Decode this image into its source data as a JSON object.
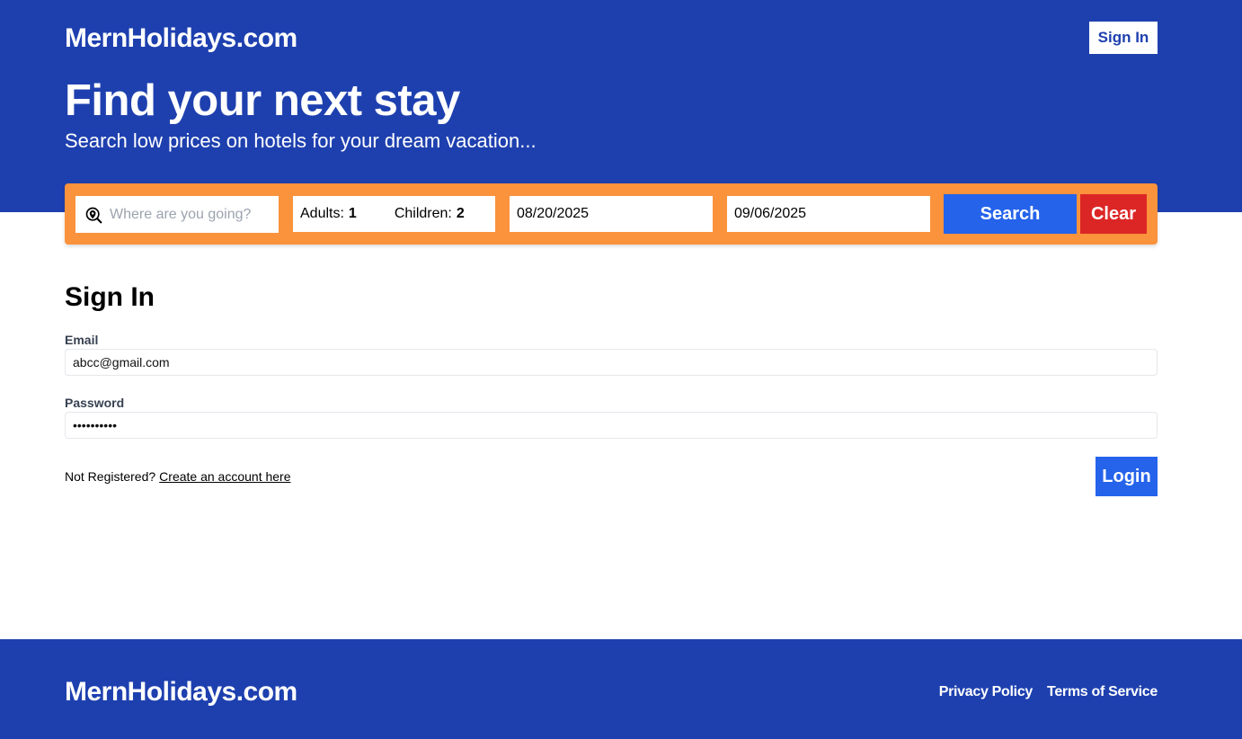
{
  "header": {
    "logo": "MernHolidays.com",
    "signin_label": "Sign In",
    "hero_title": "Find your next stay",
    "hero_subtitle": "Search low prices on hotels for your dream vacation..."
  },
  "search": {
    "destination_placeholder": "Where are you going?",
    "destination_value": "",
    "adults_label": "Adults:",
    "adults_value": "1",
    "children_label": "Children:",
    "children_value": "2",
    "check_in": "08/20/2025",
    "check_out": "09/06/2025",
    "search_label": "Search",
    "clear_label": "Clear"
  },
  "signin_form": {
    "title": "Sign In",
    "email_label": "Email",
    "email_value": "abcc@gmail.com",
    "password_label": "Password",
    "password_value": "••••••••••",
    "not_registered": "Not Registered?",
    "create_account_link": "Create an account here",
    "login_label": "Login"
  },
  "footer": {
    "logo": "MernHolidays.com",
    "links": [
      "Privacy Policy",
      "Terms of Service"
    ]
  },
  "colors": {
    "brand_blue": "#1e40af",
    "button_blue": "#2563eb",
    "search_orange": "#fb923c",
    "clear_red": "#dc2626"
  },
  "icons": {
    "destination": "map-pin-search-icon"
  }
}
